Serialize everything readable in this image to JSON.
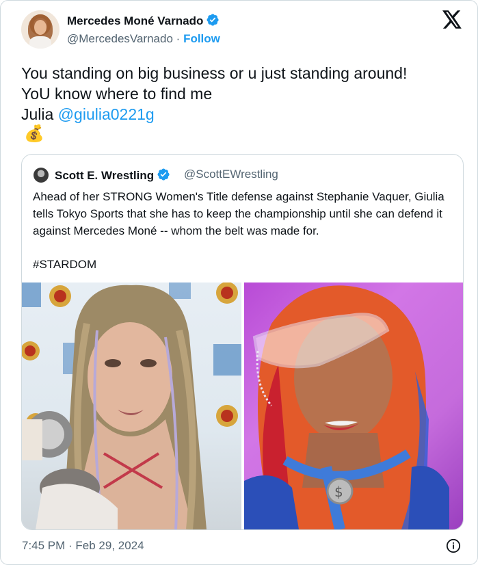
{
  "author": {
    "name": "Mercedes Moné Varnado",
    "handle": "@MercedesVarnado",
    "separator": "·",
    "follow_label": "Follow"
  },
  "tweet": {
    "line1": "You standing on big business or u just standing around!",
    "line2": "YoU know where to find me",
    "line3_prefix": "Julia ",
    "mention": "@giulia0221g",
    "emoji": "💰"
  },
  "quote": {
    "name": "Scott E. Wrestling",
    "handle": "@ScottEWrestling",
    "text": "Ahead of her STRONG Women's Title defense against Stephanie Vaquer, Giulia tells Tokyo Sports that she has to keep the championship until she can defend it against Mercedes Moné -- whom the belt was made for.",
    "hashtag": "#STARDOM"
  },
  "timestamp": "7:45 PM · Feb 29, 2024",
  "colors": {
    "accent": "#1d9bf0",
    "text": "#0f1419",
    "secondary": "#536471",
    "border": "#cfd9de"
  },
  "icons": {
    "verified": "verified-badge-icon",
    "logo": "x-logo-icon",
    "info": "info-icon"
  }
}
